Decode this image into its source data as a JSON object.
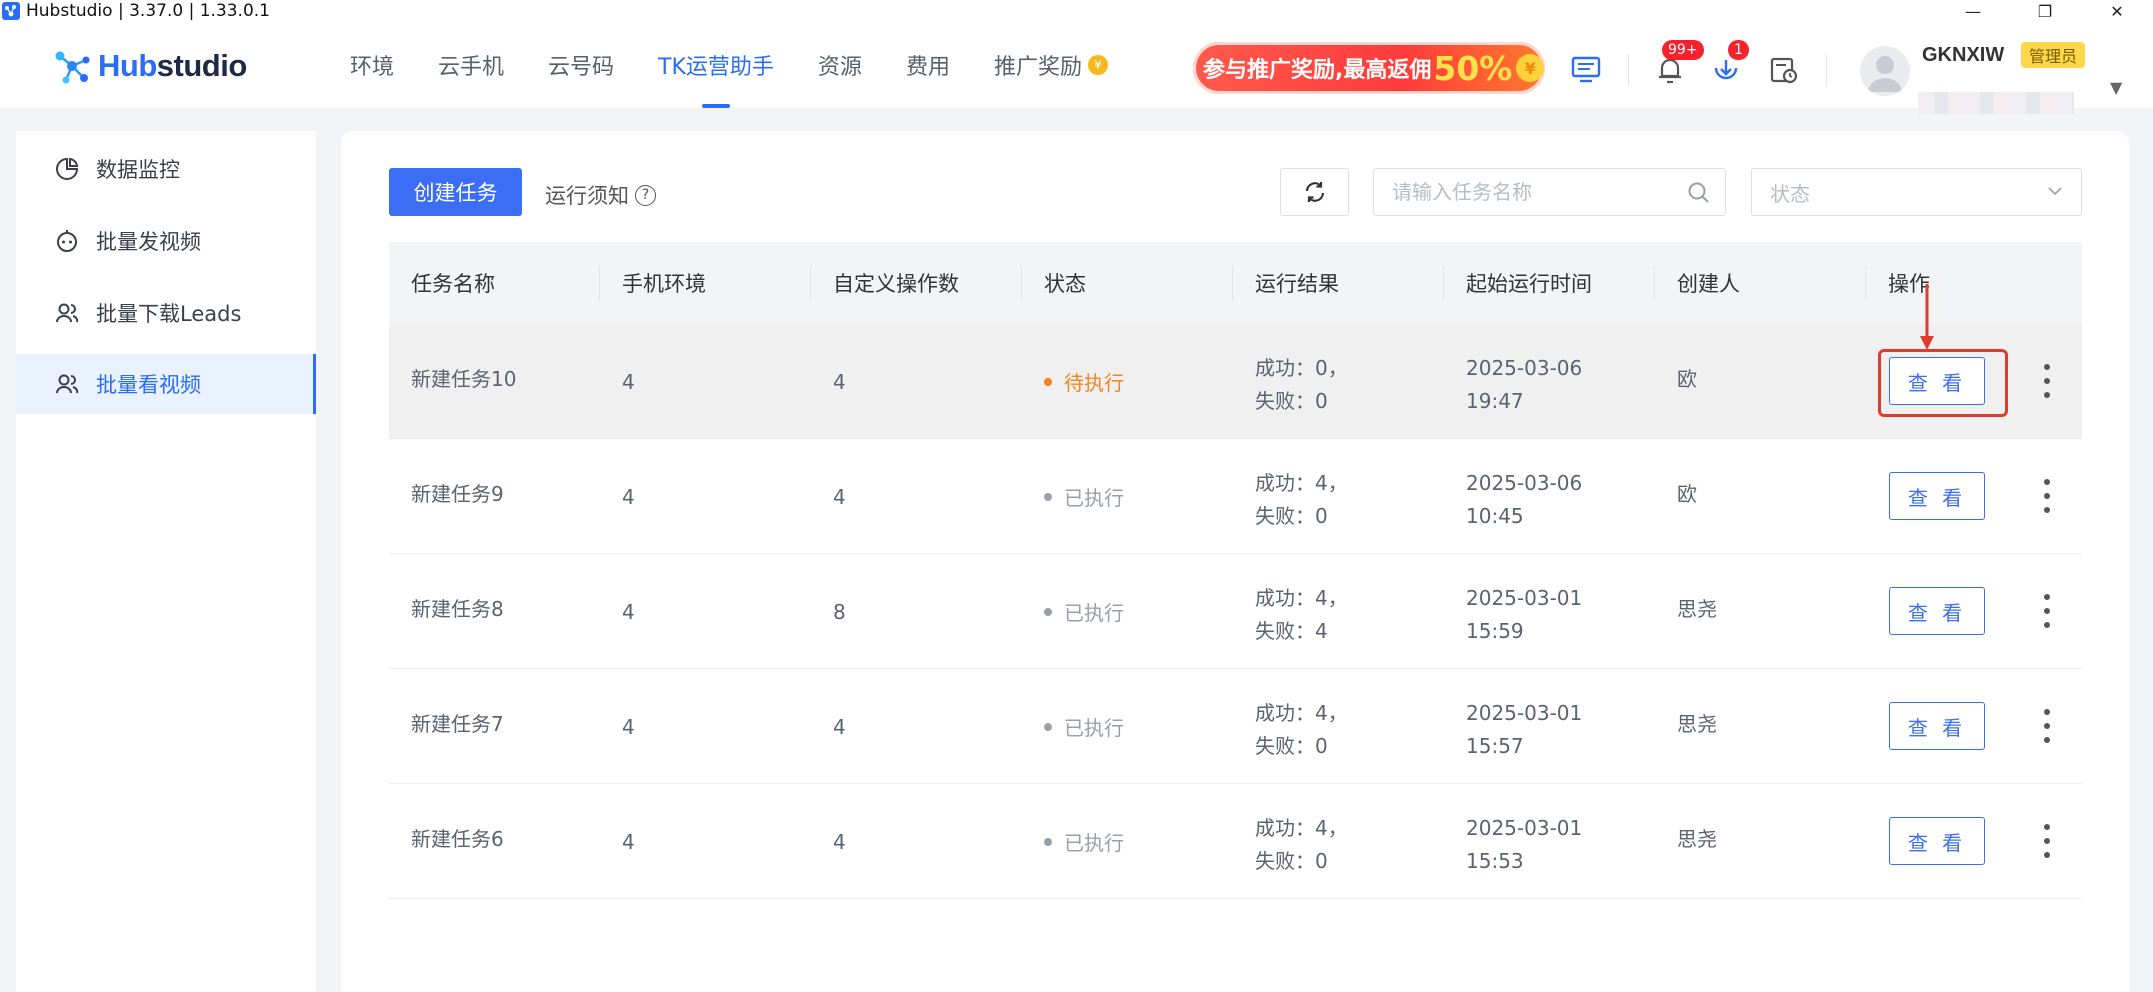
{
  "window": {
    "title": "Hubstudio | 3.37.0 | 1.33.0.1",
    "controls": {
      "minimize": "—",
      "restore": "❐",
      "close": "✕"
    }
  },
  "topbar": {
    "logo": {
      "prefix": "Hub",
      "suffix": "studio"
    },
    "nav": [
      {
        "label": "环境"
      },
      {
        "label": "云手机"
      },
      {
        "label": "云号码"
      },
      {
        "label": "TK运营助手",
        "active": true
      },
      {
        "label": "资源"
      },
      {
        "label": "费用"
      },
      {
        "label": "推广奖励"
      }
    ],
    "promo": {
      "text": "参与推广奖励,最高返佣",
      "percent": "50%"
    },
    "notifications_badge": "99+",
    "downloads_badge": "1",
    "user": {
      "name": "GKNXIW",
      "role": "管理员"
    },
    "colors": {
      "accent": "#2a6df6",
      "badge": "#f5222d"
    }
  },
  "sidebar": {
    "items": [
      {
        "label": "数据监控",
        "icon": "chart-pie-icon"
      },
      {
        "label": "批量发视频",
        "icon": "robot-icon"
      },
      {
        "label": "批量下载Leads",
        "icon": "users-icon"
      },
      {
        "label": "批量看视频",
        "icon": "users-icon",
        "active": true
      }
    ]
  },
  "toolbar": {
    "create_label": "创建任务",
    "notice_label": "运行须知",
    "search_placeholder": "请输入任务名称",
    "status_placeholder": "状态"
  },
  "table": {
    "columns": [
      "任务名称",
      "手机环境",
      "自定义操作数",
      "状态",
      "运行结果",
      "起始运行时间",
      "创建人",
      "操作"
    ],
    "view_label": "查 看",
    "rows": [
      {
        "name": "新建任务10",
        "env": "4",
        "ops": "4",
        "status": "待执行",
        "status_color": "#f5841f",
        "result1": "成功：0，",
        "result2": "失败：0",
        "date": "2025-03-06",
        "time": "19:47",
        "creator": "欧"
      },
      {
        "name": "新建任务9",
        "env": "4",
        "ops": "4",
        "status": "已执行",
        "status_color": "#9a9ea8",
        "result1": "成功：4，",
        "result2": "失败：0",
        "date": "2025-03-06",
        "time": "10:45",
        "creator": "欧"
      },
      {
        "name": "新建任务8",
        "env": "4",
        "ops": "8",
        "status": "已执行",
        "status_color": "#9a9ea8",
        "result1": "成功：4，",
        "result2": "失败：4",
        "date": "2025-03-01",
        "time": "15:59",
        "creator": "思尧"
      },
      {
        "name": "新建任务7",
        "env": "4",
        "ops": "4",
        "status": "已执行",
        "status_color": "#9a9ea8",
        "result1": "成功：4，",
        "result2": "失败：0",
        "date": "2025-03-01",
        "time": "15:57",
        "creator": "思尧"
      },
      {
        "name": "新建任务6",
        "env": "4",
        "ops": "4",
        "status": "已执行",
        "status_color": "#9a9ea8",
        "result1": "成功：4，",
        "result2": "失败：0",
        "date": "2025-03-01",
        "time": "15:53",
        "creator": "思尧"
      }
    ]
  }
}
